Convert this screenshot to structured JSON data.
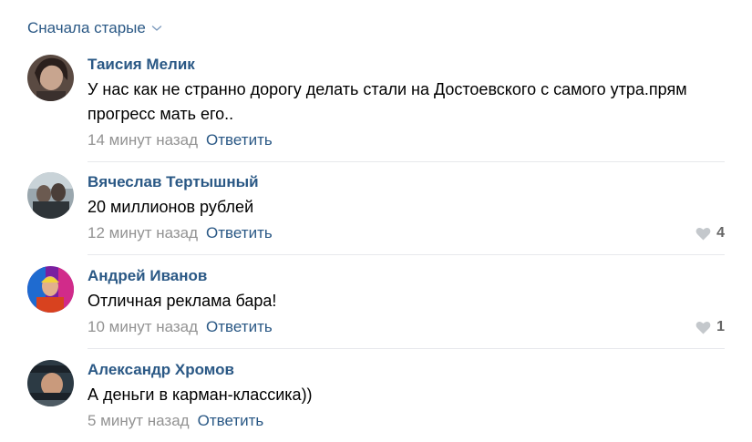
{
  "sort": {
    "label": "Сначала старые"
  },
  "comments": [
    {
      "author": "Таисия Мелик",
      "text": "У нас как не странно дорогу делать стали на Достоевского с самого утра.прям прогресс мать его..",
      "time": "14 минут назад",
      "reply": "Ответить",
      "likes": ""
    },
    {
      "author": "Вячеслав Тертышный",
      "text": "20 миллионов рублей",
      "time": "12 минут назад",
      "reply": "Ответить",
      "likes": "4"
    },
    {
      "author": "Андрей Иванов",
      "text": "Отличная реклама бара!",
      "time": "10 минут назад",
      "reply": "Ответить",
      "likes": "1"
    },
    {
      "author": "Александр Хромов",
      "text": "А деньги в карман-классика))",
      "time": "5 минут назад",
      "reply": "Ответить",
      "likes": ""
    }
  ],
  "colors": {
    "link": "#2a5885",
    "muted": "#939393",
    "divider": "#e7e8ec",
    "like": "#c4c8cc"
  },
  "icons": {
    "sort": "chevron-down-icon",
    "like": "heart-icon"
  }
}
